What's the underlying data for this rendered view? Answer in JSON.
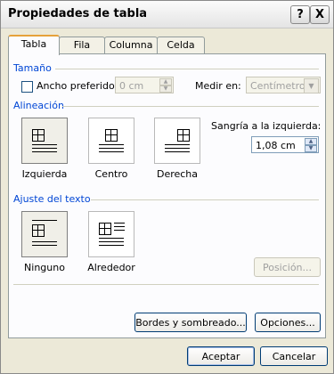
{
  "window": {
    "title": "Propiedades de tabla"
  },
  "titlebar_buttons": {
    "help": "?",
    "close": "X"
  },
  "tabs": [
    {
      "label": "Tabla"
    },
    {
      "label": "Fila"
    },
    {
      "label": "Columna"
    },
    {
      "label": "Celda"
    }
  ],
  "size": {
    "title": "Tamaño",
    "preferred_width_label": "Ancho preferido:",
    "preferred_width_value": "0 cm",
    "measure_label": "Medir en:",
    "measure_value": "Centímetros"
  },
  "alignment": {
    "title": "Alineación",
    "options": [
      {
        "label": "Izquierda",
        "selected": true
      },
      {
        "label": "Centro",
        "selected": false
      },
      {
        "label": "Derecha",
        "selected": false
      }
    ],
    "indent_label": "Sangría a la izquierda:",
    "indent_value": "1,08 cm"
  },
  "text_wrapping": {
    "title": "Ajuste del texto",
    "options": [
      {
        "label": "Ninguno",
        "selected": true
      },
      {
        "label": "Alrededor",
        "selected": false
      }
    ],
    "position_button": "Posición..."
  },
  "panel_buttons": {
    "borders": "Bordes y sombreado...",
    "options": "Opciones..."
  },
  "dialog_buttons": {
    "accept": "Aceptar",
    "cancel": "Cancelar"
  }
}
